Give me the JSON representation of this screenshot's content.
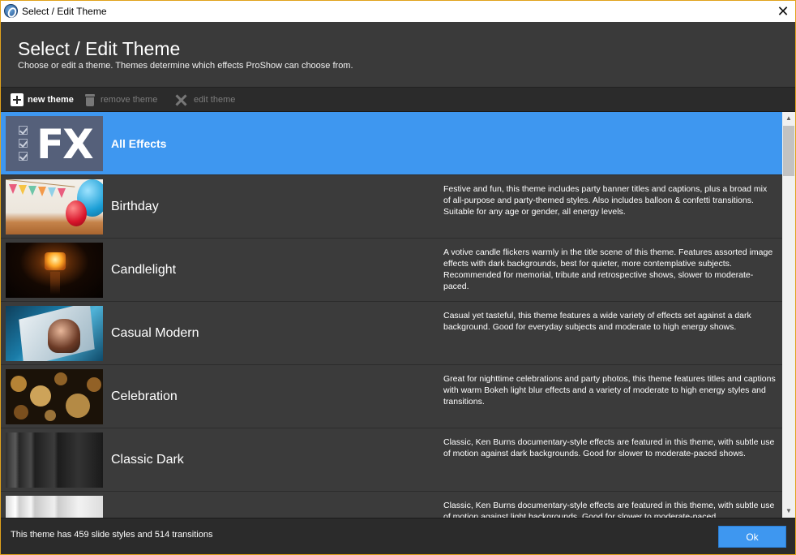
{
  "window": {
    "title": "Select / Edit Theme",
    "close_label": "✕"
  },
  "header": {
    "title": "Select / Edit Theme",
    "subtitle": "Choose or edit a theme. Themes determine which effects ProShow can choose from."
  },
  "toolbar": {
    "new_theme": "new theme",
    "remove_theme": "remove theme",
    "edit_theme": "edit theme"
  },
  "themes": [
    {
      "name": "All Effects",
      "description": "",
      "selected": true,
      "thumbnail": "fx-checklist-icon"
    },
    {
      "name": "Birthday",
      "description": "Festive and fun, this theme includes party banner titles and captions, plus a broad mix of all-purpose and party-themed styles. Also includes balloon & confetti transitions. Suitable for any age or gender, all energy levels.",
      "thumbnail": "balloons-image"
    },
    {
      "name": "Candlelight",
      "description": "A votive candle flickers warmly in the title scene of this theme. Features assorted image effects with dark backgrounds, best for quieter, more contemplative subjects. Recommended for memorial, tribute and retrospective shows, slower to moderate-paced.",
      "thumbnail": "candle-image"
    },
    {
      "name": "Casual Modern",
      "description": "Casual yet tasteful, this theme features a wide variety of effects set against a dark background. Good for everyday subjects and moderate to high energy shows.",
      "thumbnail": "photo-frame-image"
    },
    {
      "name": "Celebration",
      "description": "Great for nighttime celebrations and party photos, this theme features titles and captions with warm Bokeh light blur effects and a variety of moderate to high energy styles and transitions.",
      "thumbnail": "bokeh-image"
    },
    {
      "name": "Classic Dark",
      "description": "Classic, Ken Burns documentary-style effects are featured in this theme, with subtle use of motion against dark backgrounds. Good for slower to moderate-paced shows.",
      "thumbnail": "dark-panels-image"
    },
    {
      "name": "",
      "description": "Classic, Ken Burns documentary-style effects are featured in this theme, with subtle use of motion against light backgrounds. Good for slower to moderate-paced",
      "thumbnail": "light-panels-image"
    }
  ],
  "scrollbar": {
    "up": "▲",
    "down": "▼"
  },
  "footer": {
    "status": "This theme has 459 slide styles and 514 transitions",
    "ok_label": "Ok"
  },
  "colors": {
    "accent": "#3e97f0",
    "background": "#3b3b3b",
    "window_border": "#e0a21c"
  }
}
